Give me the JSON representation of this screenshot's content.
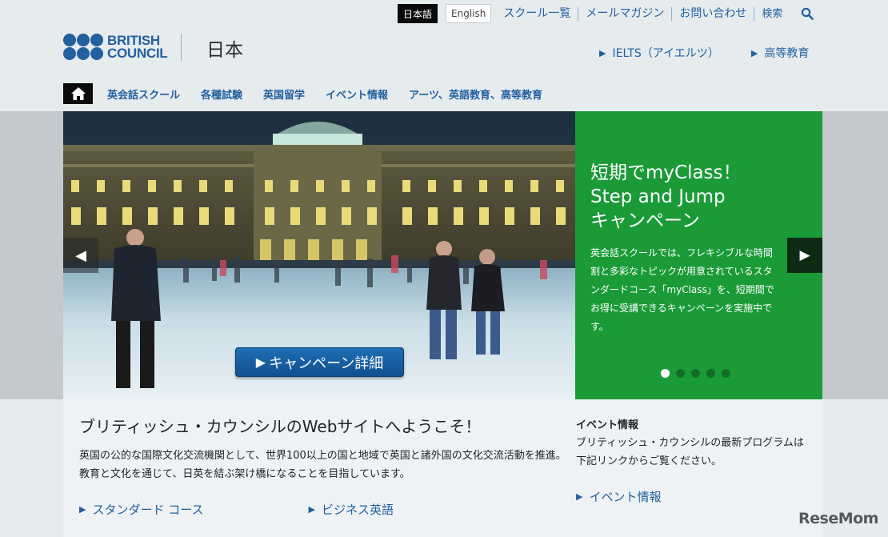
{
  "header": {
    "lang_active": "日本語",
    "lang_other": "English",
    "util_links": [
      "スクール一覧",
      "メールマガジン",
      "お問い合わせ"
    ],
    "search_label": "検索",
    "logo_line1": "BRITISH",
    "logo_line2": "COUNCIL",
    "country": "日本",
    "promo_links": [
      "IELTS（アイエルツ）",
      "高等教育"
    ],
    "brand_color": "#23609f"
  },
  "nav": {
    "items": [
      "英会話スクール",
      "各種試験",
      "英国留学",
      "イベント情報",
      "アーツ、英語教育、高等教育"
    ]
  },
  "hero": {
    "title": [
      "短期でmyClass！",
      "Step and Jump",
      "キャンペーン"
    ],
    "body": "英会話スクールでは、フレキシブルな時間割と多彩なトピックが用意されているスタンダードコース「myClass」を、短期間でお得に受講できるキャンペーンを実施中です。",
    "cta": "キャンペーン詳細",
    "slide_count": 5,
    "active_slide": 1,
    "panel_color": "#1a9b37"
  },
  "main": {
    "welcome": "ブリティッシュ・カウンシルのWebサイトへようこそ！",
    "intro": "英国の公的な国際文化交流機関として、世界100以上の国と地域で英国と諸外国の文化交流活動を推進。教育と文化を通じて、日英を結ぶ架け橋になることを目指しています。",
    "links": [
      "スタンダード コース",
      "ビジネス英語"
    ]
  },
  "sidebar": {
    "title": "イベント情報",
    "body": "ブリティッシュ・カウンシルの最新プログラムは下記リンクからご覧ください。",
    "link": "イベント情報"
  },
  "watermark": "ReseMom"
}
